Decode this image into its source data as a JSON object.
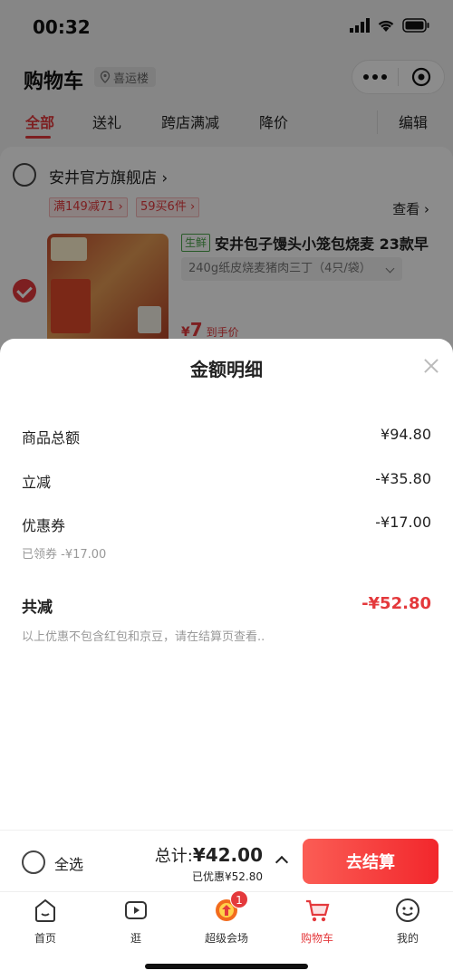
{
  "status_bar": {
    "time": "00:32"
  },
  "header": {
    "title": "购物车",
    "location": "喜运楼"
  },
  "tabs": [
    {
      "label": "全部",
      "active": true
    },
    {
      "label": "送礼"
    },
    {
      "label": "跨店满减"
    },
    {
      "label": "降价"
    },
    {
      "label": "编辑"
    }
  ],
  "shop": {
    "name": "安井官方旗舰店",
    "promos": [
      "满149减71 ›",
      "59买6件 ›"
    ],
    "see_more": "查看 ›",
    "product": {
      "fresh_tag": "生鲜",
      "name": "安井包子馒头小笼包烧麦 23款早",
      "spec": "240g纸皮烧麦猪肉三丁（4只/袋）",
      "price_symbol": "¥",
      "price": "7",
      "price_note": "到手价"
    }
  },
  "sheet": {
    "title": "金额明细",
    "rows": [
      {
        "label": "商品总额",
        "value": "¥94.80"
      },
      {
        "label": "立减",
        "value": "-¥35.80"
      },
      {
        "label": "优惠券",
        "value": "-¥17.00",
        "sub": "已领券 -¥17.00"
      }
    ],
    "total_label": "共减",
    "total_value": "-¥52.80",
    "disclaimer": "以上优惠不包含红包和京豆，请在结算页查看.."
  },
  "checkout": {
    "select_all": "全选",
    "total_prefix": "总计:",
    "total_amount": "¥42.00",
    "saved": "已优惠¥52.80",
    "button": "去结算"
  },
  "bottom_nav": [
    {
      "label": "首页",
      "icon": "home-icon"
    },
    {
      "label": "逛",
      "icon": "video-icon"
    },
    {
      "label": "超级会场",
      "icon": "super-venue-icon",
      "badge": "1"
    },
    {
      "label": "购物车",
      "icon": "cart-icon",
      "active": true
    },
    {
      "label": "我的",
      "icon": "profile-icon"
    }
  ],
  "colors": {
    "accent": "#e4393c",
    "fresh": "#4aa44a"
  }
}
